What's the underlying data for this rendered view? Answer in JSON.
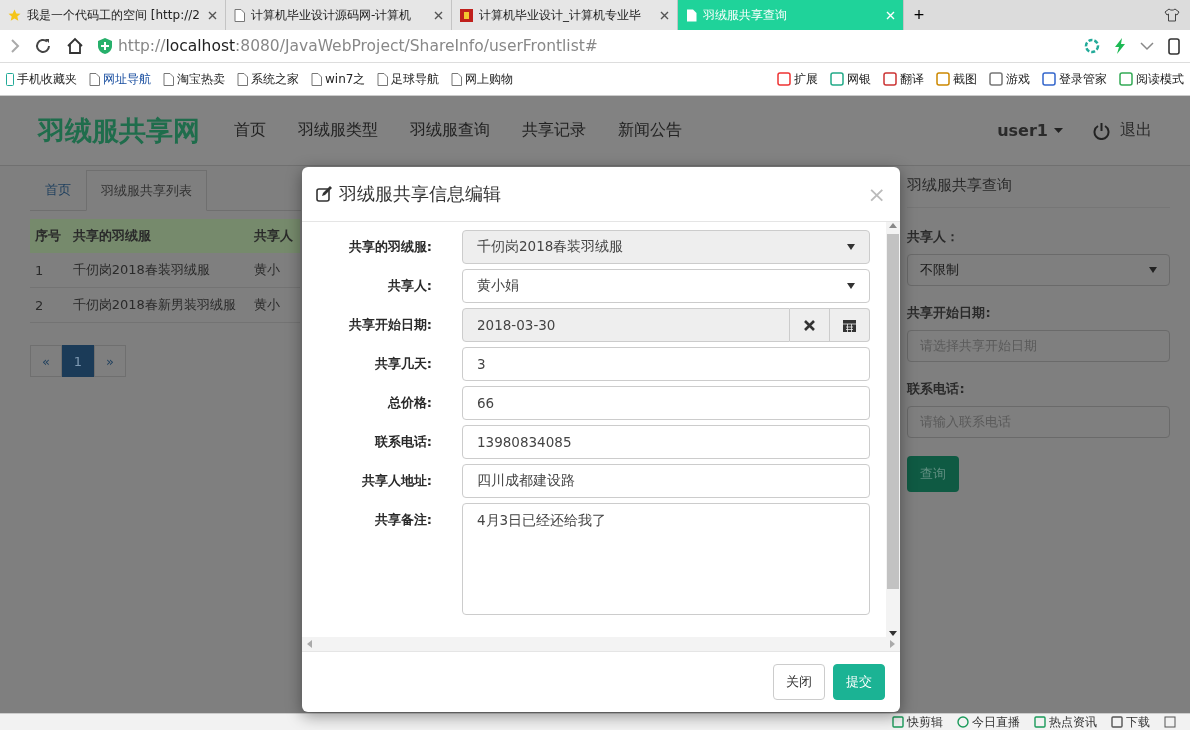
{
  "browser": {
    "tabs": [
      {
        "title": "我是一个代码工的空间 [http://2",
        "selected": false
      },
      {
        "title": "计算机毕业设计源码网-计算机",
        "selected": false
      },
      {
        "title": "计算机毕业设计_计算机专业毕",
        "selected": false
      },
      {
        "title": "羽绒服共享查询",
        "selected": true
      }
    ],
    "new_tab": "+",
    "address": "http://**localhost**:8080/JavaWebProject/ShareInfo/userFrontlist#",
    "bookmarks": [
      "手机收藏夹",
      "网址导航",
      "淘宝热卖",
      "系统之家",
      "win7之",
      "足球导航",
      "网上购物"
    ],
    "tools": [
      "扩展",
      "网银",
      "翻译",
      "截图",
      "游戏",
      "登录管家",
      "阅读模式"
    ]
  },
  "site": {
    "logo": "羽绒服共享网",
    "nav": [
      "首页",
      "羽绒服类型",
      "羽绒服查询",
      "共享记录",
      "新闻公告"
    ],
    "user": "user1",
    "logout": "退出",
    "breadcrumb": [
      {
        "label": "首页",
        "selected": false
      },
      {
        "label": "羽绒服共享列表",
        "selected": true
      }
    ],
    "table": {
      "columns": [
        "序号",
        "共享的羽绒服",
        "共享人"
      ],
      "rows": [
        [
          "1",
          "千仞岗2018春装羽绒服",
          "黄小"
        ],
        [
          "2",
          "千仞岗2018春新男装羽绒服",
          "黄小"
        ]
      ]
    },
    "pagination": [
      {
        "label": "«",
        "selected": false
      },
      {
        "label": "1",
        "selected": true
      },
      {
        "label": "»",
        "selected": false
      }
    ],
    "query": {
      "title": "羽绒服共享查询",
      "fields": [
        {
          "label": "共享人：",
          "kind": "select",
          "value": "不限制"
        },
        {
          "label": "共享开始日期:",
          "kind": "text",
          "placeholder": "请选择共享开始日期"
        },
        {
          "label": "联系电话:",
          "kind": "text",
          "placeholder": "请输入联系电话"
        }
      ],
      "button": "查询"
    }
  },
  "modal": {
    "title": "羽绒服共享信息编辑",
    "close": "×",
    "fields": [
      {
        "label": "共享的羽绒服:",
        "kind": "select",
        "value": "千仞岗2018春装羽绒服",
        "disabled": true
      },
      {
        "label": "共享人:",
        "kind": "select",
        "value": "黄小娟",
        "disabled": false
      },
      {
        "label": "共享开始日期:",
        "kind": "date",
        "value": "2018-03-30",
        "disabled": true
      },
      {
        "label": "共享几天:",
        "kind": "text",
        "value": "3",
        "disabled": false
      },
      {
        "label": "总价格:",
        "kind": "text",
        "value": "66",
        "disabled": false
      },
      {
        "label": "联系电话:",
        "kind": "text",
        "value": "13980834085",
        "disabled": false
      },
      {
        "label": "共享人地址:",
        "kind": "text",
        "value": "四川成都建设路",
        "disabled": false
      },
      {
        "label": "共享备注:",
        "kind": "textarea",
        "value": "4月3日已经还给我了",
        "disabled": false
      }
    ],
    "buttons": [
      {
        "label": "关闭",
        "kind": "default"
      },
      {
        "label": "提交",
        "kind": "primary"
      }
    ]
  },
  "status_bar": [
    "快剪辑",
    "今日直播",
    "热点资讯",
    "下载"
  ]
}
